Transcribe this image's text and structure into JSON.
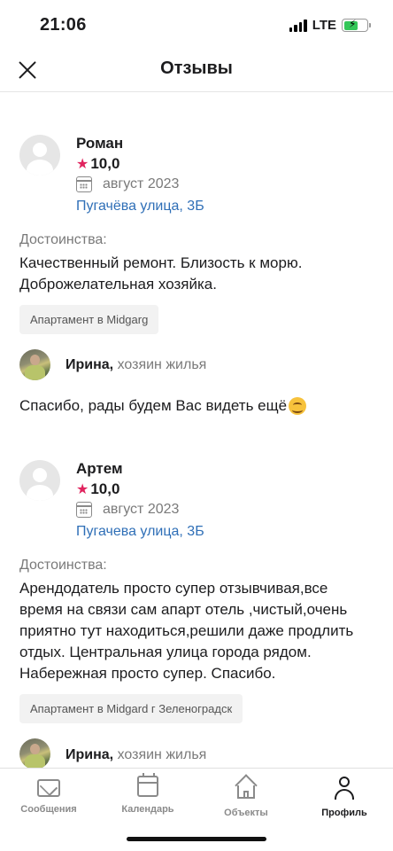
{
  "status_bar": {
    "time": "21:06",
    "network": "LTE"
  },
  "header": {
    "title": "Отзывы",
    "close_icon": "close-icon"
  },
  "reviews": [
    {
      "name": "Роман",
      "rating": "10,0",
      "date": "август 2023",
      "address": "Пугачёва улица, 3Б",
      "pros_label": "Достоинства:",
      "pros_text": "Качественный ремонт. Близость к морю. Доброжелательная хозяйка.",
      "tag": "Апартамент в Midgarg",
      "reply": {
        "host_name": "Ирина,",
        "host_role": "хозяин жилья",
        "text": "Спасибо, рады будем Вас видеть ещё"
      }
    },
    {
      "name": "Артем",
      "rating": "10,0",
      "date": "август 2023",
      "address": "Пугачева улица, 3Б",
      "pros_label": "Достоинства:",
      "pros_text": "Арендодатель просто супер отзывчивая,все время на связи сам апарт отель ,чистый,очень приятно тут находиться,решили даже продлить отдых. Центральная улица города рядом. Набережная просто супер. Спасибо.",
      "tag": "Апартамент в Midgard г Зеленоградск",
      "reply": {
        "host_name": "Ирина,",
        "host_role": "хозяин жилья"
      }
    }
  ],
  "tab_bar": {
    "tabs": [
      {
        "label": "Сообщения",
        "icon": "mail-icon"
      },
      {
        "label": "Календарь",
        "icon": "calendar-icon"
      },
      {
        "label": "Объекты",
        "icon": "home-icon"
      },
      {
        "label": "Профиль",
        "icon": "user-icon",
        "active": true
      }
    ]
  }
}
